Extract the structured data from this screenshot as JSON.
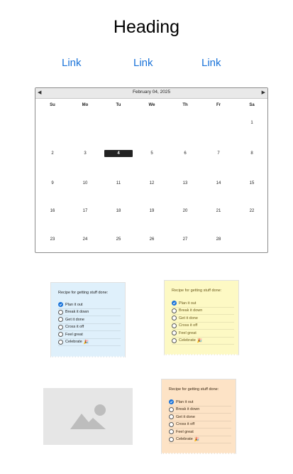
{
  "page": {
    "heading": "Heading"
  },
  "links": [
    "Link",
    "Link",
    "Link"
  ],
  "calendar": {
    "title": "February 04, 2025",
    "prev_label": "◀",
    "next_label": "▶",
    "weekdays": [
      "Su",
      "Mo",
      "Tu",
      "We",
      "Th",
      "Fr",
      "Sa"
    ],
    "selected_day": "4",
    "weeks": [
      [
        "",
        "",
        "",
        "",
        "",
        "",
        "1"
      ],
      [
        "2",
        "3",
        "4",
        "5",
        "6",
        "7",
        "8"
      ],
      [
        "9",
        "10",
        "11",
        "12",
        "13",
        "14",
        "15"
      ],
      [
        "16",
        "17",
        "18",
        "19",
        "20",
        "21",
        "22"
      ],
      [
        "23",
        "24",
        "25",
        "26",
        "27",
        "28",
        ""
      ]
    ]
  },
  "notes": [
    {
      "color": "#dff0fb",
      "title": "Recipe for getting stuff done:",
      "items": [
        {
          "label": "Plan it out",
          "checked": true
        },
        {
          "label": "Break it down",
          "checked": false
        },
        {
          "label": "Get it done",
          "checked": false
        },
        {
          "label": "Cross it off",
          "checked": false
        },
        {
          "label": "Feel great",
          "checked": false
        },
        {
          "label": "Celebrate",
          "checked": false,
          "emoji": "🎉"
        }
      ]
    },
    {
      "color": "#fdf9c4",
      "title": "Recipe for getting stuff done:",
      "items": [
        {
          "label": "Plan it out",
          "checked": true
        },
        {
          "label": "Break it down",
          "checked": false
        },
        {
          "label": "Get it done",
          "checked": false
        },
        {
          "label": "Cross it off",
          "checked": false
        },
        {
          "label": "Feel great",
          "checked": false
        },
        {
          "label": "Celebrate",
          "checked": false,
          "emoji": "🎉"
        }
      ]
    },
    {
      "color": "#fde3c6",
      "title": "Recipe for getting stuff done:",
      "items": [
        {
          "label": "Plan it out",
          "checked": true
        },
        {
          "label": "Break it down",
          "checked": false
        },
        {
          "label": "Get it done",
          "checked": false
        },
        {
          "label": "Cross it off",
          "checked": false
        },
        {
          "label": "Feel great",
          "checked": false
        },
        {
          "label": "Celebrate",
          "checked": false,
          "emoji": "🎉"
        }
      ]
    }
  ],
  "image_placeholder": {
    "icon": "image-placeholder-icon"
  }
}
